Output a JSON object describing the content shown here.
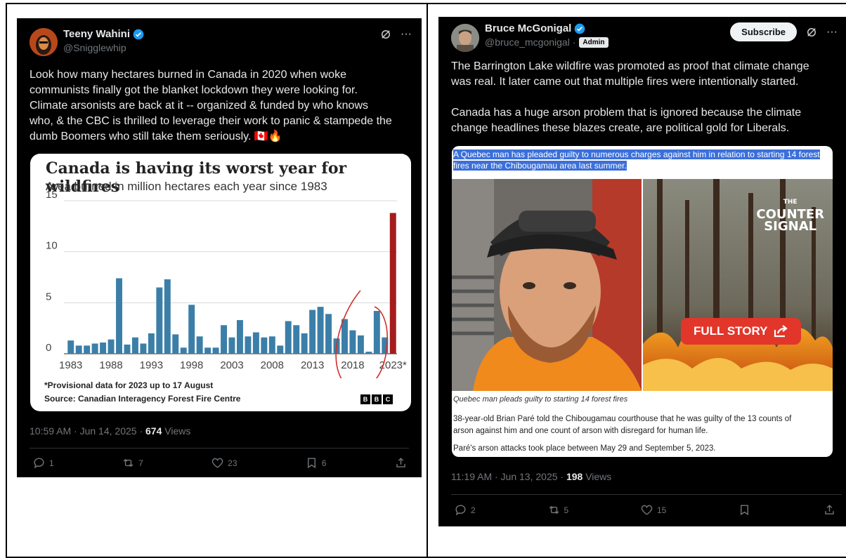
{
  "left_tweet": {
    "author_name": "Teeny Wahini",
    "handle": "@Snigglewhip",
    "body": "Look how many hectares burned in Canada in 2020 when woke\ncommunists finally got the blanket lockdown they were looking for.\nClimate arsonists are back at it -- organized & funded by who knows\nwho, & the CBC is thrilled to leverage their work to panic & stampede the\ndumb Boomers who still take them seriously. 🇨🇦🔥",
    "timestamp": "10:59 AM · Jun 14, 2025 · ",
    "views_count": "674",
    "views_label": " Views",
    "replies": "1",
    "reposts": "7",
    "likes": "23",
    "bookmarks": "6",
    "icons": [
      "verified-badge-icon",
      "grok-icon",
      "more-icon",
      "reply-icon",
      "repost-icon",
      "like-icon",
      "bookmark-icon",
      "share-icon"
    ]
  },
  "chart_card": {
    "note": "*Provisional data for 2023 up to 17 August",
    "source": "Source: Canadian Interagency Forest Fire Centre",
    "logo_letters": [
      "B",
      "B",
      "C"
    ]
  },
  "chart_data": {
    "type": "bar",
    "title": "Canada is having its worst year for wildfires",
    "subtitle": "Area burned in million hectares each year since 1983",
    "xlabel": "",
    "ylabel": "",
    "ylim": [
      0,
      15
    ],
    "yticks": [
      "15",
      "10",
      "5",
      "0"
    ],
    "xticks": [
      "1983",
      "1988",
      "1993",
      "1998",
      "2003",
      "2008",
      "2013",
      "2018",
      "2023*"
    ],
    "categories": [
      "1983",
      "1984",
      "1985",
      "1986",
      "1987",
      "1988",
      "1989",
      "1990",
      "1991",
      "1992",
      "1993",
      "1994",
      "1995",
      "1996",
      "1997",
      "1998",
      "1999",
      "2000",
      "2001",
      "2002",
      "2003",
      "2004",
      "2005",
      "2006",
      "2007",
      "2008",
      "2009",
      "2010",
      "2011",
      "2012",
      "2013",
      "2014",
      "2015",
      "2016",
      "2017",
      "2018",
      "2019",
      "2020",
      "2021",
      "2022",
      "2023"
    ],
    "values": [
      1.3,
      0.8,
      0.8,
      1.0,
      1.1,
      1.4,
      7.4,
      0.9,
      1.6,
      1.0,
      2.0,
      6.5,
      7.3,
      1.9,
      0.6,
      4.8,
      1.7,
      0.6,
      0.6,
      2.8,
      1.6,
      3.3,
      1.7,
      2.1,
      1.6,
      1.7,
      0.8,
      3.2,
      2.8,
      2.0,
      4.3,
      4.6,
      3.9,
      1.5,
      3.4,
      2.3,
      1.8,
      0.2,
      4.2,
      1.6,
      13.8
    ],
    "bar_color": "#3b7fa8",
    "highlight_color": "#a51c1c",
    "grid": true
  },
  "right_tweet": {
    "author_name": "Bruce McGonigal",
    "handle": "@bruce_mcgonigal ·",
    "admin_label": "Admin",
    "subscribe_label": "Subscribe",
    "body": "The Barrington Lake wildfire was promoted as proof that climate change\nwas real. It later came out that multiple fires were intentionally started.\n\nCanada has a huge arson problem that is ignored because the climate\nchange headlines these blazes create, are political gold for Liberals.",
    "timestamp": "11:19 AM · Jun 13, 2025 · ",
    "views_count": "198",
    "views_label": " Views",
    "replies": "2",
    "reposts": "5",
    "likes": "15",
    "icons": [
      "verified-badge-icon",
      "grok-icon",
      "more-icon",
      "reply-icon",
      "repost-icon",
      "like-icon",
      "bookmark-icon",
      "share-icon"
    ]
  },
  "article": {
    "headline": "A Quebec man has pleaded guilty to numerous charges against him in relation to starting 14 forest fires near the Chibougamau area last summer.",
    "logo_line1": "THE",
    "logo_line2": "COUNTER",
    "logo_line3": "SIGNAL",
    "full_story_label": "FULL STORY",
    "caption": "Quebec man pleads guilty to starting 14 forest fires",
    "paragraph1": "38-year-old Brian Paré told the Chibougamau courthouse that he was guilty of the 13 counts of\narson against him and one count of arson with disregard for human life.",
    "paragraph2": "Paré's arson attacks took place between May 29 and September 5, 2023."
  }
}
